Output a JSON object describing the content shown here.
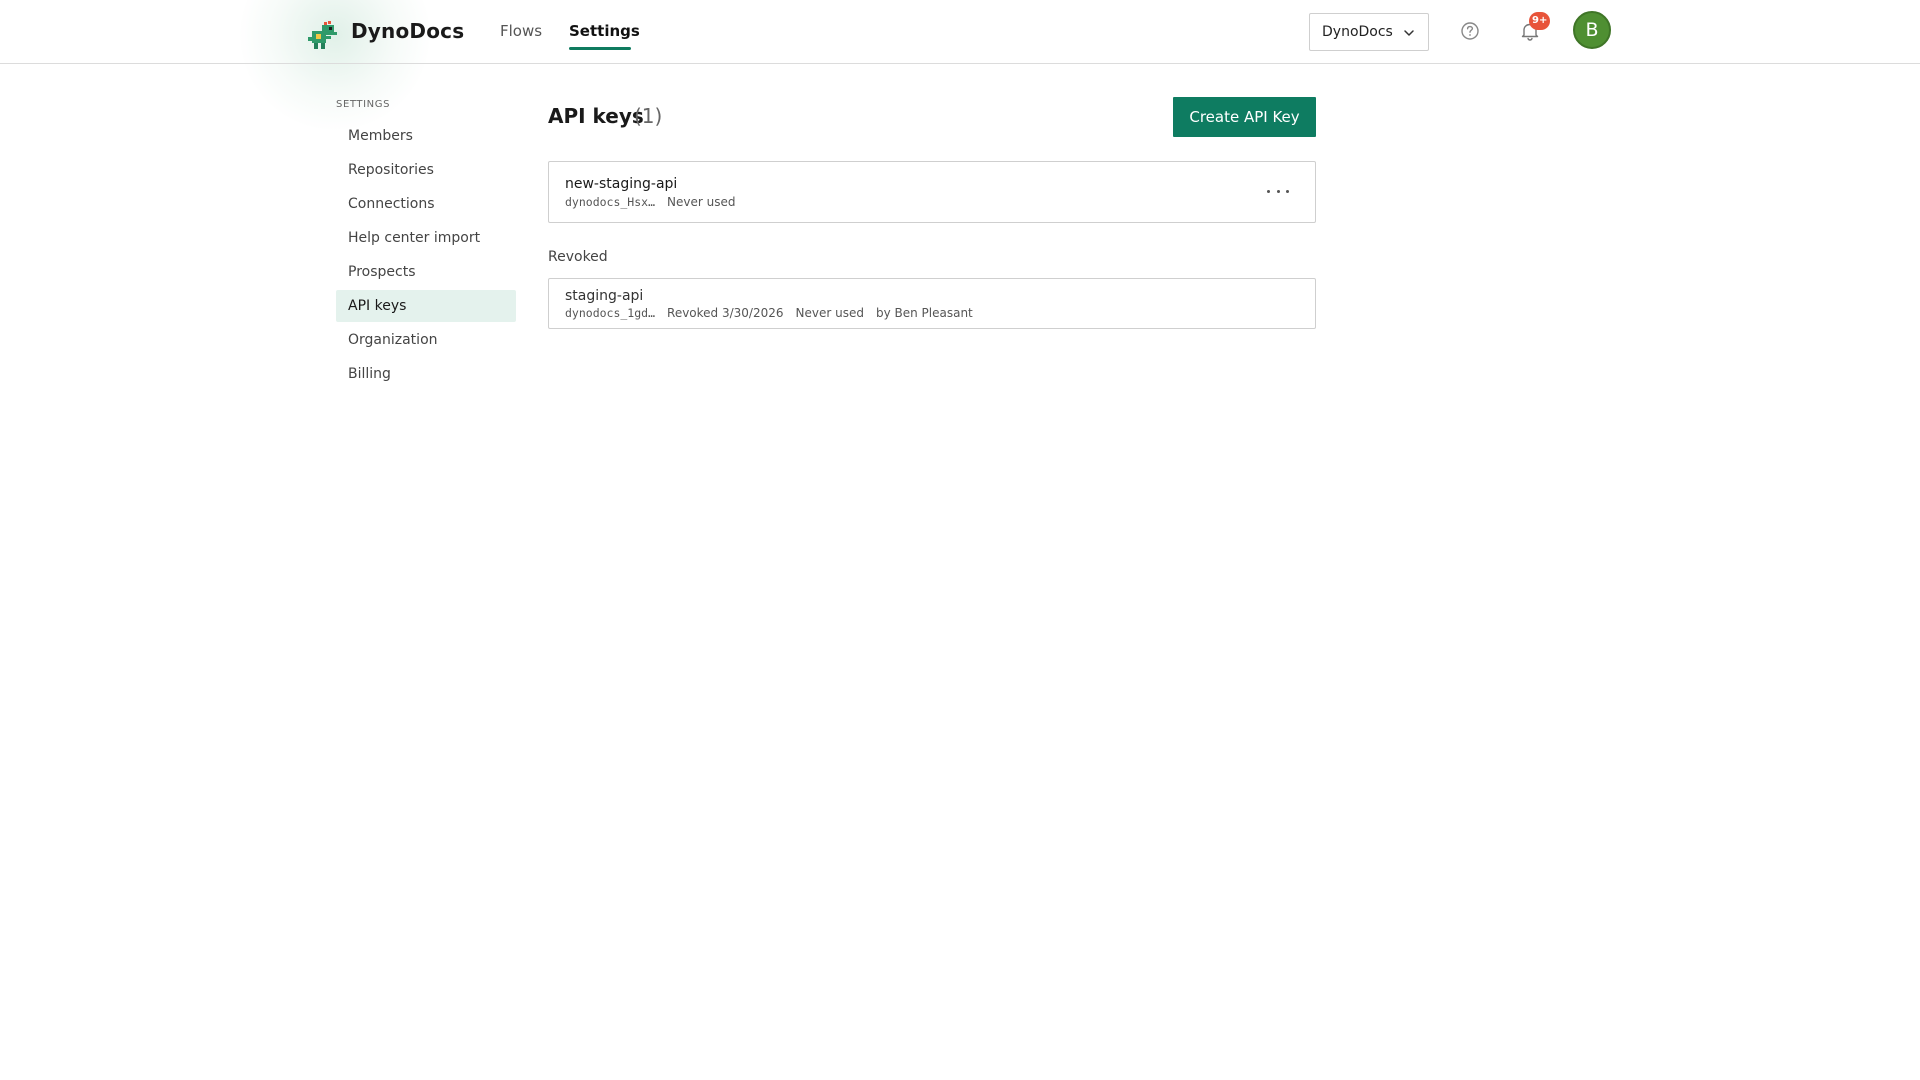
{
  "header": {
    "brand": "DynoDocs",
    "nav": [
      {
        "label": "Flows",
        "active": false
      },
      {
        "label": "Settings",
        "active": true
      }
    ],
    "org_selector": {
      "value": "DynoDocs",
      "icon": "chevron-down-icon"
    },
    "help_icon": "question-circle-icon",
    "notifications": {
      "icon": "bell-icon",
      "badge": "9+"
    },
    "avatar_initial": "B"
  },
  "sidebar": {
    "heading": "SETTINGS",
    "items": [
      {
        "label": "Members",
        "active": false
      },
      {
        "label": "Repositories",
        "active": false
      },
      {
        "label": "Connections",
        "active": false
      },
      {
        "label": "Help center import",
        "active": false
      },
      {
        "label": "Prospects",
        "active": false
      },
      {
        "label": "API keys",
        "active": true
      },
      {
        "label": "Organization",
        "active": false
      },
      {
        "label": "Billing",
        "active": false
      }
    ]
  },
  "main": {
    "title": "API keys",
    "count": "(1)",
    "create_button": "Create API Key",
    "active_keys": [
      {
        "name": "new-staging-api",
        "key": "dynodocs_Hsx…",
        "usage": "Never used"
      }
    ],
    "revoked_heading": "Revoked",
    "revoked_keys": [
      {
        "name": "staging-api",
        "key": "dynodocs_1gd…",
        "revoked": "Revoked 3/30/2026",
        "usage": "Never used",
        "by": "by Ben Pleasant"
      }
    ]
  },
  "colors": {
    "accent": "#0e7c61",
    "active_sidebar_bg": "#e4f2ed",
    "badge": "#e8543a",
    "avatar": "#4f8f32"
  }
}
